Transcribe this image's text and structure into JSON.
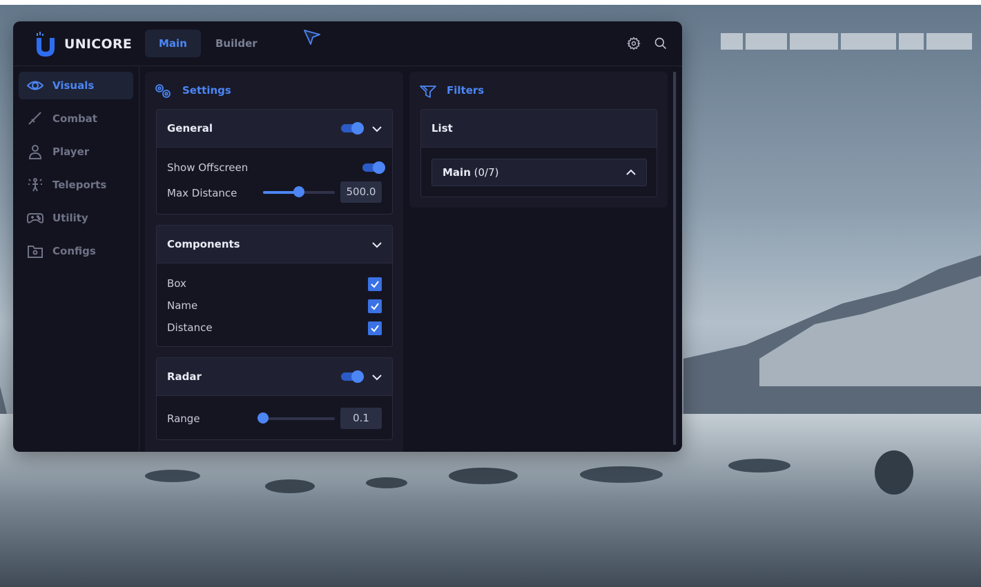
{
  "app": {
    "name": "UNICORE"
  },
  "tabs": [
    {
      "label": "Main",
      "active": true
    },
    {
      "label": "Builder",
      "active": false
    }
  ],
  "header_icons": [
    "gear-icon",
    "search-icon"
  ],
  "sidebar": {
    "items": [
      {
        "label": "Visuals",
        "icon": "eye-icon",
        "active": true
      },
      {
        "label": "Combat",
        "icon": "sword-icon",
        "active": false
      },
      {
        "label": "Player",
        "icon": "user-icon",
        "active": false
      },
      {
        "label": "Teleports",
        "icon": "teleport-icon",
        "active": false
      },
      {
        "label": "Utility",
        "icon": "gamepad-icon",
        "active": false
      },
      {
        "label": "Configs",
        "icon": "folder-icon",
        "active": false
      }
    ]
  },
  "settings_panel": {
    "title": "Settings",
    "general": {
      "title": "General",
      "enabled": true,
      "show_offscreen_label": "Show Offscreen",
      "show_offscreen": true,
      "max_distance_label": "Max Distance",
      "max_distance_value": "500.0",
      "max_distance_fraction": 0.5
    },
    "components": {
      "title": "Components",
      "items": [
        {
          "label": "Box",
          "checked": true
        },
        {
          "label": "Name",
          "checked": true
        },
        {
          "label": "Distance",
          "checked": true
        }
      ]
    },
    "radar": {
      "title": "Radar",
      "enabled": true,
      "range_label": "Range",
      "range_value": "0.1",
      "range_fraction": 0.0
    }
  },
  "filters_panel": {
    "title": "Filters",
    "list_title": "List",
    "dropdown_name": "Main",
    "dropdown_count": "(0/7)",
    "expanded": true
  },
  "colors": {
    "accent": "#4c86f4",
    "window_bg": "#13131f",
    "panel_bg": "#191927"
  }
}
